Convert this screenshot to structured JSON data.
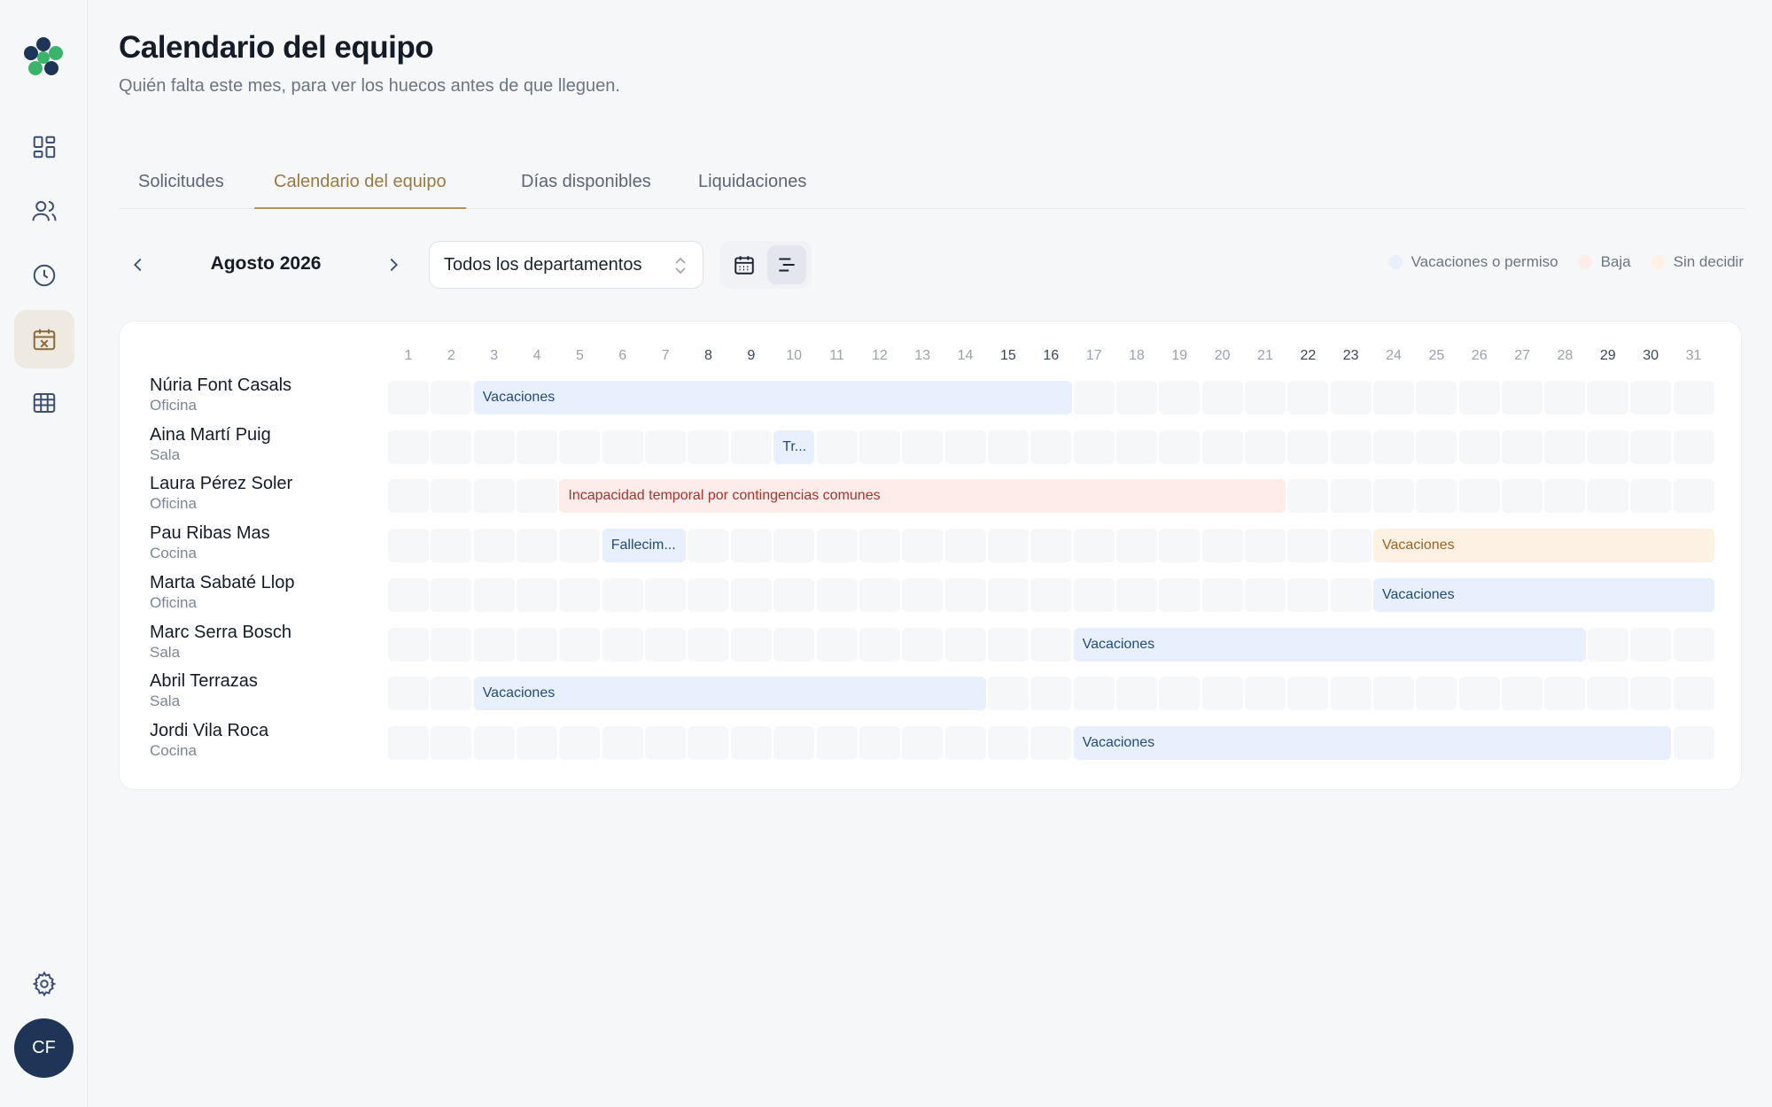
{
  "sidebar": {
    "avatar_initials": "CF",
    "nav": [
      "dashboard-icon",
      "users-icon",
      "clock-icon",
      "calendar-off-icon",
      "table-icon"
    ],
    "settings_icon": "gear-icon"
  },
  "header": {
    "title": "Calendario del equipo",
    "subtitle": "Quién falta este mes, para ver los huecos antes de que lleguen."
  },
  "tabs": [
    {
      "label": "Solicitudes",
      "active": false
    },
    {
      "label": "Calendario del equipo",
      "active": true
    },
    {
      "label": "Días disponibles",
      "active": false
    },
    {
      "label": "Liquidaciones",
      "active": false
    }
  ],
  "toolbar": {
    "month": "Agosto 2026",
    "department": "Todos los departamentos"
  },
  "legend": [
    {
      "label": "Vacaciones o permiso",
      "color": "#e7f0fc"
    },
    {
      "label": "Baja",
      "color": "#fdecea"
    },
    {
      "label": "Sin decidir",
      "color": "#fdf1e3"
    }
  ],
  "calendar": {
    "days": [
      "1",
      "2",
      "3",
      "4",
      "5",
      "6",
      "7",
      "8",
      "9",
      "10",
      "11",
      "12",
      "13",
      "14",
      "15",
      "16",
      "17",
      "18",
      "19",
      "20",
      "21",
      "22",
      "23",
      "24",
      "25",
      "26",
      "27",
      "28",
      "29",
      "30",
      "31"
    ],
    "weekdays": [
      8,
      9,
      15,
      16,
      22,
      23,
      29,
      30
    ],
    "people": [
      {
        "name": "Núria Font Casals",
        "dept": "Oficina",
        "absences": [
          {
            "label": "Vacaciones",
            "type": "vac",
            "start": 3,
            "end": 16
          }
        ]
      },
      {
        "name": "Aina Martí Puig",
        "dept": "Sala",
        "absences": [
          {
            "label": "Tr...",
            "type": "vac",
            "start": 10,
            "end": 10
          }
        ]
      },
      {
        "name": "Laura Pérez Soler",
        "dept": "Oficina",
        "absences": [
          {
            "label": "Incapacidad temporal por contingencias comunes",
            "type": "sick",
            "start": 5,
            "end": 21
          }
        ]
      },
      {
        "name": "Pau Ribas Mas",
        "dept": "Cocina",
        "absences": [
          {
            "label": "Fallecim...",
            "type": "vac",
            "start": 6,
            "end": 7
          },
          {
            "label": "Vacaciones",
            "type": "pending",
            "start": 24,
            "end": 31
          }
        ]
      },
      {
        "name": "Marta Sabaté Llop",
        "dept": "Oficina",
        "absences": [
          {
            "label": "Vacaciones",
            "type": "vac",
            "start": 24,
            "end": 31
          }
        ]
      },
      {
        "name": "Marc Serra Bosch",
        "dept": "Sala",
        "absences": [
          {
            "label": "Vacaciones",
            "type": "vac",
            "start": 17,
            "end": 28
          }
        ]
      },
      {
        "name": "Abril Terrazas",
        "dept": "Sala",
        "absences": [
          {
            "label": "Vacaciones",
            "type": "vac",
            "start": 3,
            "end": 14
          }
        ]
      },
      {
        "name": "Jordi Vila Roca",
        "dept": "Cocina",
        "absences": [
          {
            "label": "Vacaciones",
            "type": "vac",
            "start": 17,
            "end": 30
          }
        ]
      }
    ]
  }
}
